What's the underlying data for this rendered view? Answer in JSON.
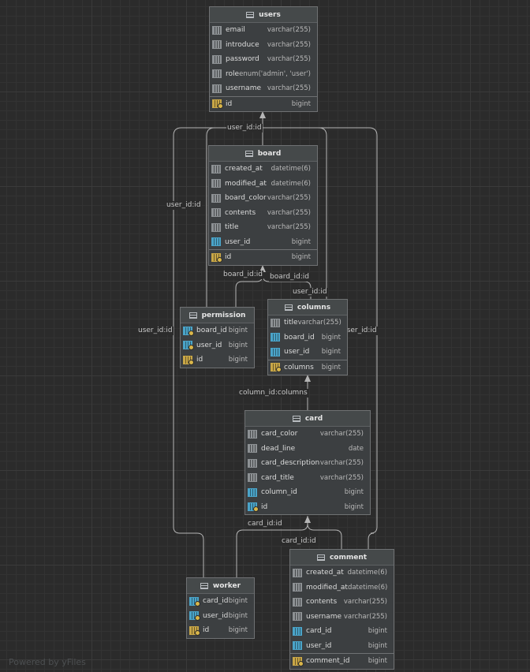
{
  "tables": {
    "users": {
      "name": "users",
      "columns": [
        {
          "name": "email",
          "type": "varchar(255)",
          "icon": "column-icon"
        },
        {
          "name": "introduce",
          "type": "varchar(255)",
          "icon": "column-icon"
        },
        {
          "name": "password",
          "type": "varchar(255)",
          "icon": "column-icon"
        },
        {
          "name": "role",
          "type": "enum('admin', 'user')",
          "icon": "column-icon"
        },
        {
          "name": "username",
          "type": "varchar(255)",
          "icon": "column-icon"
        }
      ],
      "keys": [
        {
          "name": "id",
          "type": "bigint",
          "icon": "primary-key-icon"
        }
      ]
    },
    "board": {
      "name": "board",
      "columns": [
        {
          "name": "created_at",
          "type": "datetime(6)",
          "icon": "column-icon"
        },
        {
          "name": "modified_at",
          "type": "datetime(6)",
          "icon": "column-icon"
        },
        {
          "name": "board_color",
          "type": "varchar(255)",
          "icon": "column-icon"
        },
        {
          "name": "contents",
          "type": "varchar(255)",
          "icon": "column-icon"
        },
        {
          "name": "title",
          "type": "varchar(255)",
          "icon": "column-icon"
        },
        {
          "name": "user_id",
          "type": "bigint",
          "icon": "foreign-key-icon"
        }
      ],
      "keys": [
        {
          "name": "id",
          "type": "bigint",
          "icon": "primary-key-icon"
        }
      ]
    },
    "permission": {
      "name": "permission",
      "columns": [
        {
          "name": "board_id",
          "type": "bigint",
          "icon": "primary-foreign-key-icon"
        },
        {
          "name": "user_id",
          "type": "bigint",
          "icon": "primary-foreign-key-icon"
        },
        {
          "name": "id",
          "type": "bigint",
          "icon": "primary-key-icon"
        }
      ],
      "keys": []
    },
    "columns": {
      "name": "columns",
      "columns": [
        {
          "name": "title",
          "type": "varchar(255)",
          "icon": "column-icon"
        },
        {
          "name": "board_id",
          "type": "bigint",
          "icon": "foreign-key-icon"
        },
        {
          "name": "user_id",
          "type": "bigint",
          "icon": "foreign-key-icon"
        }
      ],
      "keys": [
        {
          "name": "columns",
          "type": "bigint",
          "icon": "primary-key-icon"
        }
      ]
    },
    "card": {
      "name": "card",
      "columns": [
        {
          "name": "card_color",
          "type": "varchar(255)",
          "icon": "column-icon"
        },
        {
          "name": "dead_line",
          "type": "date",
          "icon": "column-icon"
        },
        {
          "name": "card_description",
          "type": "varchar(255)",
          "icon": "column-icon"
        },
        {
          "name": "card_title",
          "type": "varchar(255)",
          "icon": "column-icon"
        },
        {
          "name": "column_id",
          "type": "bigint",
          "icon": "foreign-key-icon"
        },
        {
          "name": "id",
          "type": "bigint",
          "icon": "primary-foreign-key-icon"
        }
      ],
      "keys": []
    },
    "worker": {
      "name": "worker",
      "columns": [
        {
          "name": "card_id",
          "type": "bigint",
          "icon": "primary-foreign-key-icon"
        },
        {
          "name": "user_id",
          "type": "bigint",
          "icon": "primary-foreign-key-icon"
        },
        {
          "name": "id",
          "type": "bigint",
          "icon": "primary-key-icon"
        }
      ],
      "keys": []
    },
    "comment": {
      "name": "comment",
      "columns": [
        {
          "name": "created_at",
          "type": "datetime(6)",
          "icon": "column-icon"
        },
        {
          "name": "modified_at",
          "type": "datetime(6)",
          "icon": "column-icon"
        },
        {
          "name": "contents",
          "type": "varchar(255)",
          "icon": "column-icon"
        },
        {
          "name": "username",
          "type": "varchar(255)",
          "icon": "column-icon"
        },
        {
          "name": "card_id",
          "type": "bigint",
          "icon": "foreign-key-icon"
        },
        {
          "name": "user_id",
          "type": "bigint",
          "icon": "foreign-key-icon"
        }
      ],
      "keys": [
        {
          "name": "comment_id",
          "type": "bigint",
          "icon": "primary-key-icon"
        }
      ]
    }
  },
  "edge_labels": {
    "board_users": "user_id:id",
    "permission_users": "user_id:id",
    "worker_users": "user_id:id",
    "permission_board": "board_id:id",
    "columns_board": "board_id:id",
    "columns_users": "user_id:id",
    "comment_users": "user_id:id",
    "card_columns": "column_id:columns",
    "worker_card": "card_id:id",
    "comment_card": "card_id:id"
  },
  "watermark": "Powered by yFiles",
  "colors": {
    "canvas": "#2b2b2b",
    "table_body": "#3c3f41",
    "edge": "#b8b8b8",
    "primary_key": "#c9a747",
    "foreign_key": "#4aa4c9"
  }
}
